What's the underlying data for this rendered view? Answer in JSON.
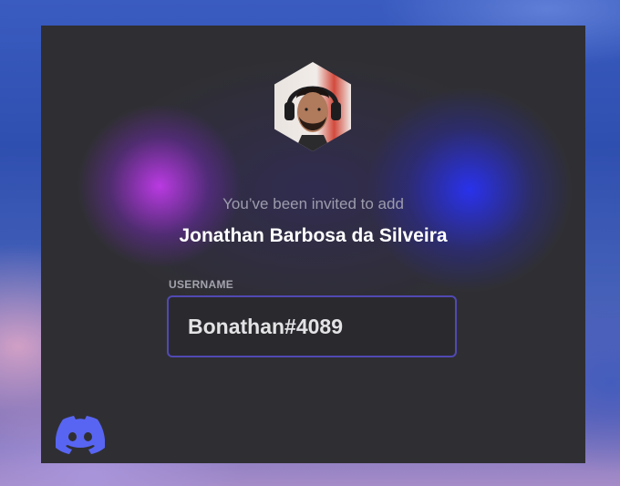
{
  "invite": {
    "subtitle": "You’ve been invited to add",
    "name": "Jonathan Barbosa da Silveira"
  },
  "username": {
    "label": "USERNAME",
    "value": "Bonathan#4089"
  },
  "colors": {
    "field_border": "#5149b3",
    "card": "#2f2f33",
    "logo": "#5865f2"
  },
  "icons": {
    "brand": "discord-logo-icon"
  }
}
